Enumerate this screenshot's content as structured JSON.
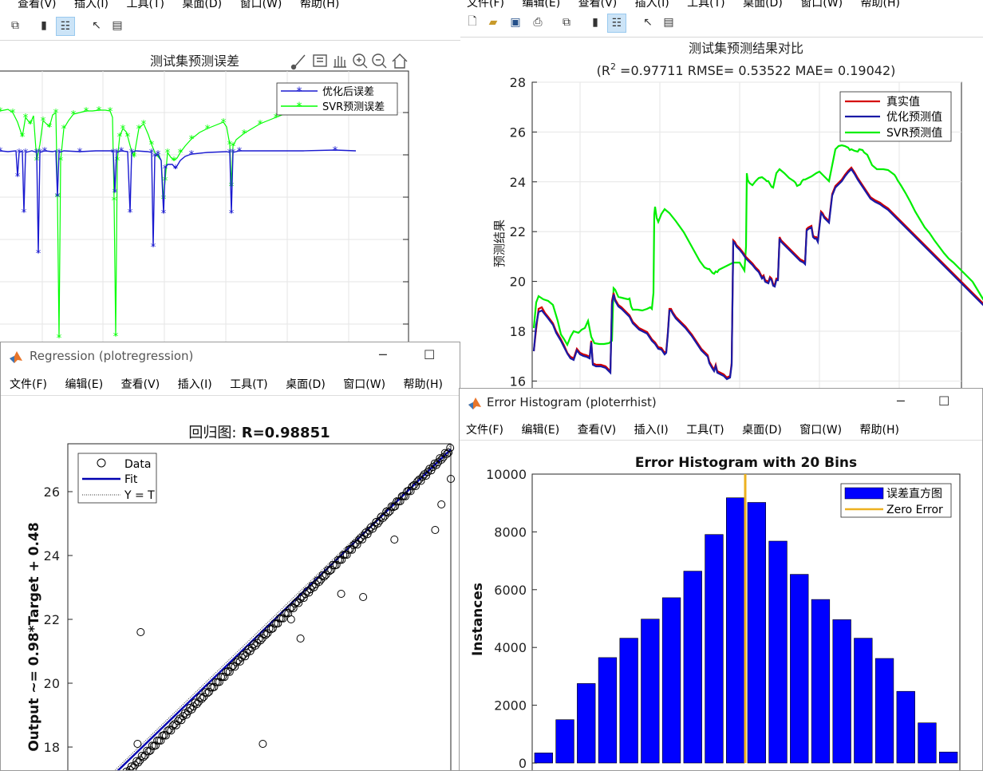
{
  "menu": [
    "文件(F)",
    "编辑(E)",
    "查看(V)",
    "插入(I)",
    "工具(T)",
    "桌面(D)",
    "窗口(W)",
    "帮助(H)"
  ],
  "menu_top_left": [
    "查看(V)",
    "插入(I)",
    "工具(T)",
    "桌面(D)",
    "窗口(W)",
    "帮助(H)"
  ],
  "menu_top_right": [
    "文件(F)",
    "编辑(E)",
    "查看(V)",
    "插入(I)",
    "工具(T)",
    "桌面(D)",
    "窗口(W)",
    "帮助(H)"
  ],
  "win_error": {
    "chart_data": {
      "type": "line",
      "title": "测试集预测误差",
      "series": [
        {
          "name": "优化后误差",
          "color": "#0000ff",
          "marker": "*"
        },
        {
          "name": "SVR预测误差",
          "color": "#00ff00",
          "marker": "*"
        }
      ]
    }
  },
  "win_compare": {
    "chart_data": {
      "type": "line",
      "title": "测试集预测结果对比",
      "subtitle_pre": "(R",
      "subtitle_sup": "2",
      "subtitle_post": " =0.97711 RMSE= 0.53522 MAE= 0.19042)",
      "ylabel": "预测结果",
      "ylim": [
        15.5,
        28
      ],
      "yticks": [
        16,
        18,
        20,
        22,
        24,
        26,
        28
      ],
      "series": [
        {
          "name": "真实值",
          "color": "#d40000"
        },
        {
          "name": "优化预测值",
          "color": "#1a1aa6"
        },
        {
          "name": "SVR预测值",
          "color": "#00ee00"
        }
      ]
    }
  },
  "win_regression": {
    "title": "Regression (plotregression)",
    "chart_data": {
      "type": "scatter",
      "title_cn": "回归图:",
      "title_val": " R=0.98851",
      "ylabel": "Output ~= 0.98*Target + 0.48",
      "ylim": [
        17,
        27.5
      ],
      "yticks": [
        18,
        20,
        22,
        24,
        26
      ],
      "legend": [
        "Data",
        "Fit",
        "Y = T"
      ],
      "fit": {
        "slope": 0.98,
        "intercept": 0.48
      }
    }
  },
  "win_hist": {
    "title": "Error Histogram (ploterrhist)",
    "chart_data": {
      "type": "bar",
      "title": "Error Histogram with 20 Bins",
      "ylabel": "Instances",
      "ylim": [
        0,
        10000
      ],
      "yticks": [
        0,
        2000,
        4000,
        6000,
        8000,
        10000
      ],
      "values": [
        350,
        1500,
        2750,
        3650,
        4320,
        4980,
        5720,
        6640,
        7910,
        9180,
        9020,
        7680,
        6530,
        5660,
        4960,
        4320,
        3620,
        2480,
        1390,
        380
      ],
      "legend": [
        "误差直方图",
        "Zero Error"
      ],
      "bar_color": "#0000ff",
      "zero_line_color": "#edb120"
    }
  }
}
